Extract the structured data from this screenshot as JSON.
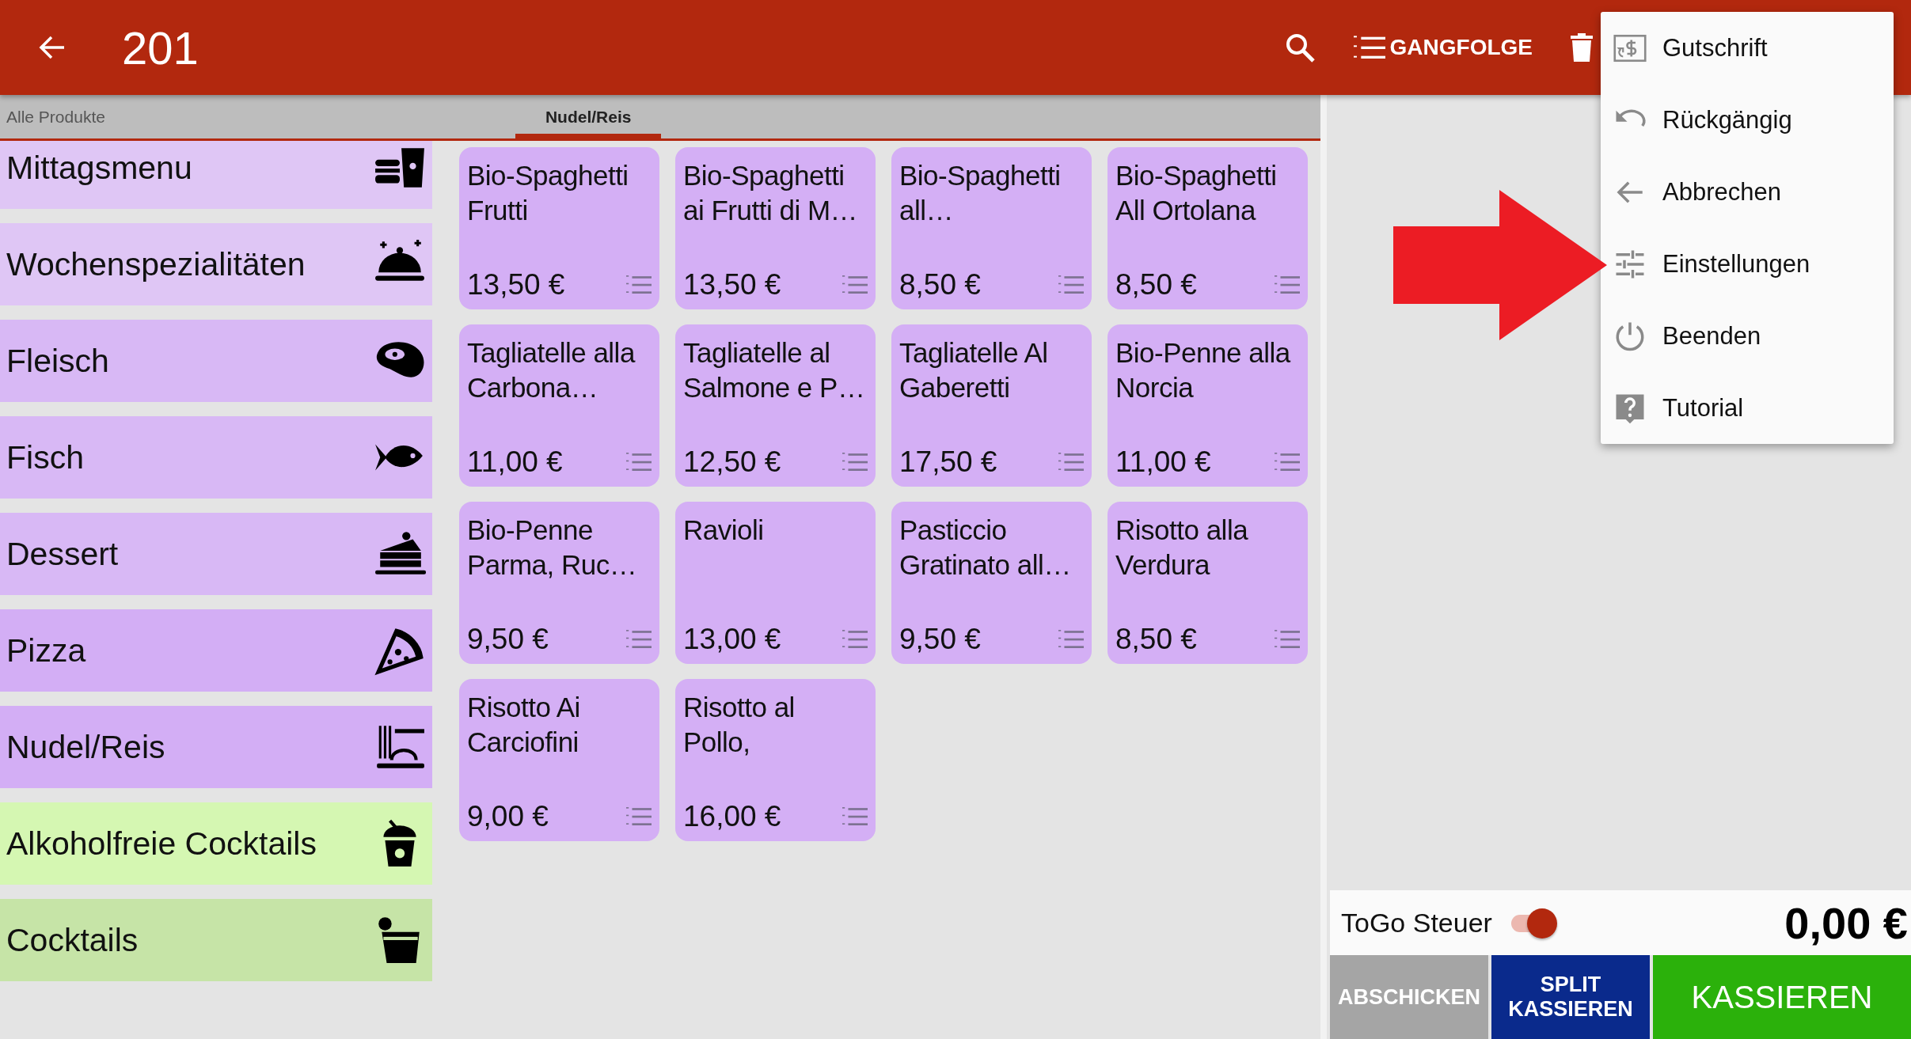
{
  "toolbar": {
    "title": "201",
    "gangfolge_label": "GANGFOLGE"
  },
  "tabs": [
    {
      "label": "Alle Produkte",
      "selected": false
    },
    {
      "label": "Nudel/Reis",
      "selected": true
    }
  ],
  "categories": [
    {
      "label": "Mittagsmenu",
      "color": "#dfc6f5"
    },
    {
      "label": "Wochenspezialitäten",
      "color": "#dfc6f5"
    },
    {
      "label": "Fleisch",
      "color": "#d8b8f5"
    },
    {
      "label": "Fisch",
      "color": "#d8b8f5"
    },
    {
      "label": "Dessert",
      "color": "#d8b8f5"
    },
    {
      "label": "Pizza",
      "color": "#d3aef5"
    },
    {
      "label": "Nudel/Reis",
      "color": "#d3aef5"
    },
    {
      "label": "Alkoholfreie Cocktails",
      "color": "#d5f7b2"
    },
    {
      "label": "Cocktails",
      "color": "#c6e4a7"
    }
  ],
  "products": [
    {
      "name": "Bio-Spaghetti Frutti",
      "price": "13,50 €"
    },
    {
      "name": "Bio-Spaghetti ai Frutti di M…",
      "price": "13,50 €"
    },
    {
      "name": "Bio-Spaghetti all…",
      "price": "8,50 €"
    },
    {
      "name": "Bio-Spaghetti All Ortolana",
      "price": "8,50 €"
    },
    {
      "name": "Tagliatelle alla Carbona…",
      "price": "11,00 €"
    },
    {
      "name": "Tagliatelle al Salmone e P…",
      "price": "12,50 €"
    },
    {
      "name": "Tagliatelle Al Gaberetti",
      "price": "17,50 €"
    },
    {
      "name": "Bio-Penne alla Norcia",
      "price": "11,00 €"
    },
    {
      "name": "Bio-Penne Parma, Ruc…",
      "price": "9,50 €"
    },
    {
      "name": "Ravioli",
      "price": "13,00 €"
    },
    {
      "name": "Pasticcio Gratinato all…",
      "price": "9,50 €"
    },
    {
      "name": "Risotto alla Verdura",
      "price": "8,50 €"
    },
    {
      "name": "Risotto Ai Carciofini",
      "price": "9,00 €"
    },
    {
      "name": "Risotto al Pollo,",
      "price": "16,00 €"
    }
  ],
  "menu": [
    {
      "label": "Gutschrift"
    },
    {
      "label": "Rückgängig"
    },
    {
      "label": "Abbrechen"
    },
    {
      "label": "Einstellungen"
    },
    {
      "label": "Beenden"
    },
    {
      "label": "Tutorial"
    }
  ],
  "togo": {
    "label": "ToGo Steuer",
    "on": true
  },
  "total": "0,00 €",
  "buttons": [
    {
      "label": "ABSCHICKEN",
      "kind": "send"
    },
    {
      "label": "SPLIT KASSIEREN",
      "kind": "split"
    },
    {
      "label": "KASSIEREN",
      "kind": "pay"
    }
  ]
}
